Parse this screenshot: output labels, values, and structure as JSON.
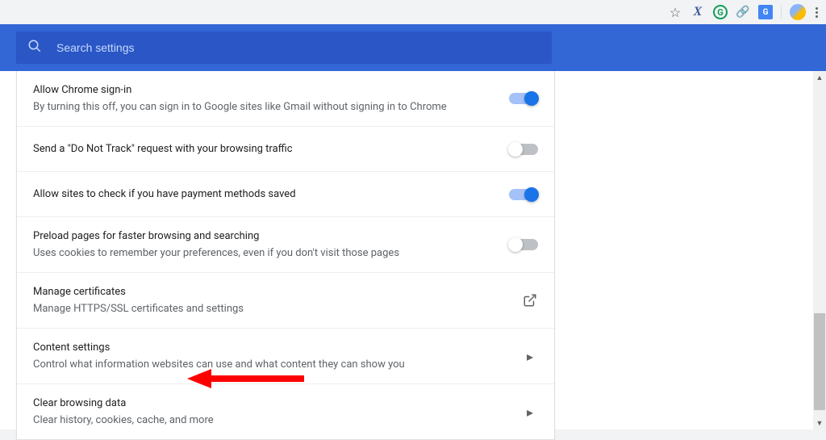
{
  "search": {
    "placeholder": "Search settings"
  },
  "rows": {
    "allow_signin": {
      "title": "Allow Chrome sign-in",
      "desc": "By turning this off, you can sign in to Google sites like Gmail without signing in to Chrome",
      "on": true
    },
    "do_not_track": {
      "title": "Send a \"Do Not Track\" request with your browsing traffic",
      "on": false
    },
    "payment_methods": {
      "title": "Allow sites to check if you have payment methods saved",
      "on": true
    },
    "preload": {
      "title": "Preload pages for faster browsing and searching",
      "desc": "Uses cookies to remember your preferences, even if you don't visit those pages",
      "on": false
    },
    "certificates": {
      "title": "Manage certificates",
      "desc": "Manage HTTPS/SSL certificates and settings"
    },
    "content_settings": {
      "title": "Content settings",
      "desc": "Control what information websites can use and what content they can show you"
    },
    "clear_browsing": {
      "title": "Clear browsing data",
      "desc": "Clear history, cookies, cache, and more"
    }
  },
  "colors": {
    "header_blue": "#3367d6",
    "toggle_on": "#1a73e8",
    "annotation_arrow": "#ff0000"
  }
}
